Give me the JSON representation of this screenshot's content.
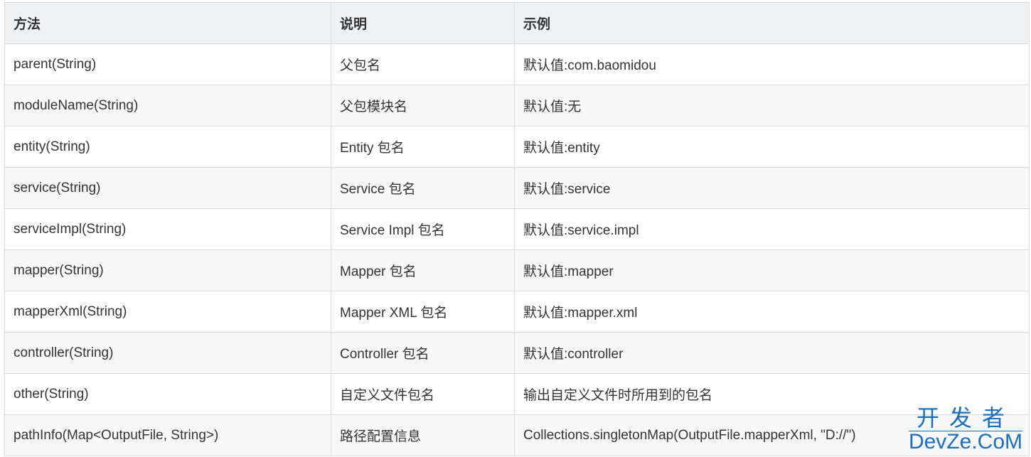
{
  "table": {
    "headers": [
      "方法",
      "说明",
      "示例"
    ],
    "rows": [
      [
        "parent(String)",
        "父包名",
        "默认值:com.baomidou"
      ],
      [
        "moduleName(String)",
        "父包模块名",
        "默认值:无"
      ],
      [
        "entity(String)",
        "Entity 包名",
        "默认值:entity"
      ],
      [
        "service(String)",
        "Service 包名",
        "默认值:service"
      ],
      [
        "serviceImpl(String)",
        "Service Impl 包名",
        "默认值:service.impl"
      ],
      [
        "mapper(String)",
        "Mapper 包名",
        "默认值:mapper"
      ],
      [
        "mapperXml(String)",
        "Mapper XML 包名",
        "默认值:mapper.xml"
      ],
      [
        "controller(String)",
        "Controller 包名",
        "默认值:controller"
      ],
      [
        "other(String)",
        "自定义文件包名",
        "输出自定义文件时所用到的包名"
      ],
      [
        "pathInfo(Map<OutputFile, String>)",
        "路径配置信息",
        "Collections.singletonMap(OutputFile.mapperXml, \"D://\")"
      ]
    ]
  },
  "watermark": {
    "cn": "开发者",
    "en": "DevZe.CoM",
    "color": "#1a6fbf"
  }
}
